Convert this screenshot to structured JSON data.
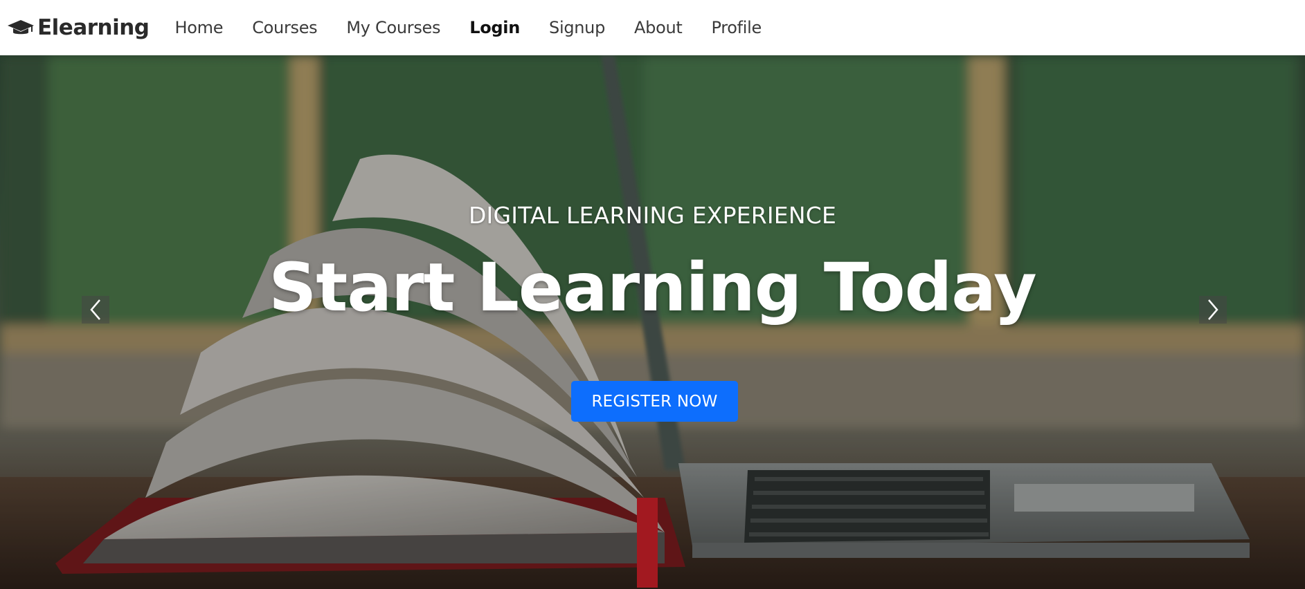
{
  "brand": {
    "name": "Elearning",
    "icon": "graduation-cap-icon"
  },
  "nav": {
    "items": [
      {
        "label": "Home",
        "active": false
      },
      {
        "label": "Courses",
        "active": false
      },
      {
        "label": "My Courses",
        "active": false
      },
      {
        "label": "Login",
        "active": true
      },
      {
        "label": "Signup",
        "active": false
      },
      {
        "label": "About",
        "active": false
      },
      {
        "label": "Profile",
        "active": false
      }
    ]
  },
  "hero": {
    "subtitle": "DIGITAL LEARNING EXPERIENCE",
    "title": "Start Learning Today",
    "cta_label": "REGISTER NOW",
    "prev_icon": "chevron-left-icon",
    "next_icon": "chevron-right-icon"
  },
  "colors": {
    "accent": "#0d6efd",
    "navbar_bg": "#ffffff",
    "nav_text": "#3a3a3a",
    "hero_text": "#ffffff"
  }
}
